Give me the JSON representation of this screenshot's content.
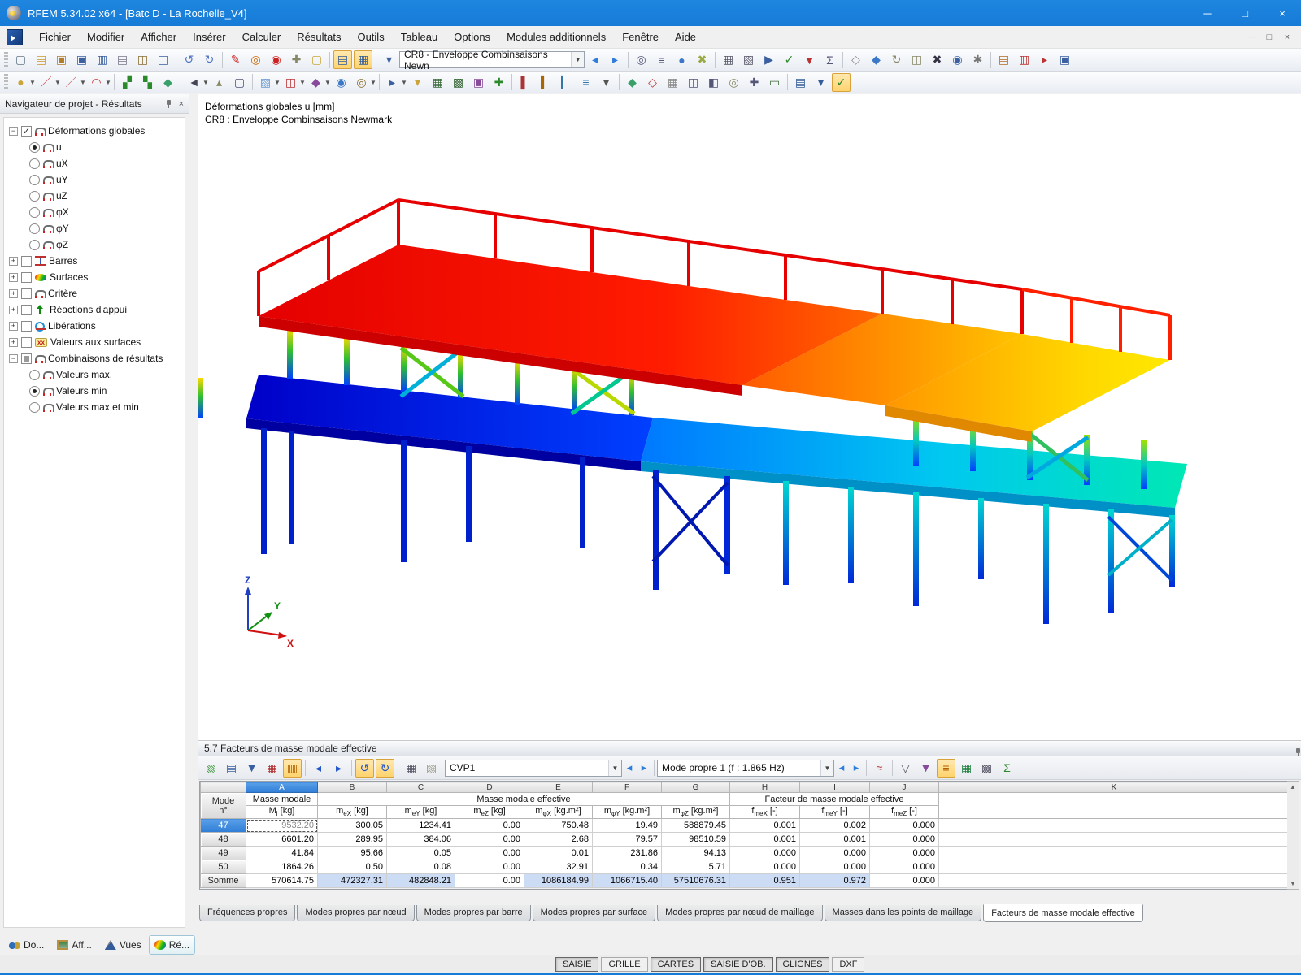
{
  "window": {
    "title": "RFEM 5.34.02 x64 - [Batc D - La Rochelle_V4]",
    "controls": {
      "minimize": "─",
      "maximize": "□",
      "close": "×"
    }
  },
  "menu": {
    "items": [
      "Fichier",
      "Modifier",
      "Afficher",
      "Insérer",
      "Calculer",
      "Résultats",
      "Outils",
      "Tableau",
      "Options",
      "Modules additionnels",
      "Fenêtre",
      "Aide"
    ]
  },
  "toolbars": {
    "case_combo": "CR8 - Enveloppe Combinsaisons Newn",
    "row1a": [
      {
        "n": "new-file",
        "g": "▢",
        "c": "#667788"
      },
      {
        "n": "open-file",
        "g": "▤",
        "c": "#c9972a"
      },
      {
        "n": "open-project",
        "g": "▣",
        "c": "#b07c2a"
      },
      {
        "n": "save-copy",
        "g": "▣",
        "c": "#3b5fa0"
      },
      {
        "n": "save",
        "g": "▥",
        "c": "#3b5fa0"
      },
      {
        "n": "print",
        "g": "▤",
        "c": "#778"
      },
      {
        "n": "print-preview",
        "g": "◫",
        "c": "#8a6d2f"
      },
      {
        "n": "export",
        "g": "◫",
        "c": "#3b5fa0"
      },
      "sep",
      {
        "n": "undo",
        "g": "↺",
        "c": "#4f73c4"
      },
      {
        "n": "redo",
        "g": "↻",
        "c": "#4f73c4"
      },
      "sep",
      {
        "n": "edit-polyline",
        "g": "✎",
        "c": "#c22"
      },
      {
        "n": "zoom-target",
        "g": "◎",
        "c": "#c60"
      },
      {
        "n": "zoom-center",
        "g": "◉",
        "c": "#c22"
      },
      {
        "n": "pick-object",
        "g": "✚",
        "c": "#886"
      },
      {
        "n": "new-comment",
        "g": "▢",
        "c": "#c9a83c"
      },
      "sep",
      {
        "n": "show-tables",
        "g": "▤",
        "c": "#335c99",
        "active": true
      },
      {
        "n": "show-grid-tables",
        "g": "▦",
        "c": "#335c99",
        "active": true
      },
      "sep",
      {
        "n": "result-case",
        "g": "▾",
        "c": "#3b5fa0"
      }
    ],
    "row1b": [
      {
        "n": "prev-case",
        "g": "◂",
        "c": "#2f7ddb"
      },
      {
        "n": "next-case",
        "g": "▸",
        "c": "#2f7ddb"
      },
      "sep",
      {
        "n": "find-numbering",
        "g": "◎",
        "c": "#557"
      },
      {
        "n": "xyz-coords",
        "g": "≡",
        "c": "#557"
      },
      {
        "n": "world-view",
        "g": "●",
        "c": "#3b78c8"
      },
      {
        "n": "axes-toggle",
        "g": "✖",
        "c": "#9a4"
      },
      "sep",
      {
        "n": "mesh",
        "g": "▦",
        "c": "#556"
      },
      {
        "n": "mesh-settings",
        "g": "▧",
        "c": "#556"
      },
      {
        "n": "calculate-all",
        "g": "▶",
        "c": "#3b5fa0"
      },
      {
        "n": "check-model",
        "g": "✓",
        "c": "#2a8a2a"
      },
      {
        "n": "loads-display",
        "g": "▼",
        "c": "#b33"
      },
      {
        "n": "results-display",
        "g": "Σ",
        "c": "#557"
      },
      "sep",
      {
        "n": "snap",
        "g": "◇",
        "c": "#888"
      },
      {
        "n": "guidelines",
        "g": "◆",
        "c": "#3b78c8"
      },
      {
        "n": "rotate-view",
        "g": "↻",
        "c": "#886"
      },
      {
        "n": "mirror",
        "g": "◫",
        "c": "#886"
      },
      {
        "n": "cut-plane",
        "g": "✖",
        "c": "#334"
      },
      {
        "n": "info",
        "g": "◉",
        "c": "#3b5fa0"
      },
      {
        "n": "settings",
        "g": "✱",
        "c": "#777"
      },
      "sep",
      {
        "n": "panel-toggle",
        "g": "▤",
        "c": "#b36a1f"
      },
      {
        "n": "print-graphic",
        "g": "▥",
        "c": "#b33"
      },
      {
        "n": "send",
        "g": "▸",
        "c": "#b33"
      },
      {
        "n": "help-layers",
        "g": "▣",
        "c": "#3b5fa0"
      }
    ],
    "row2": [
      {
        "n": "node",
        "g": "●",
        "c": "#caa53c",
        "caret": true
      },
      {
        "n": "line",
        "g": "／",
        "c": "#c33",
        "caret": true
      },
      {
        "n": "line-polyline",
        "g": "／",
        "c": "#b55",
        "caret": true
      },
      {
        "n": "arc",
        "g": "◠",
        "c": "#c33",
        "caret": true
      },
      "sep",
      {
        "n": "member",
        "g": "▞",
        "c": "#2a8a2a"
      },
      {
        "n": "member-set",
        "g": "▚",
        "c": "#2a8a2a"
      },
      {
        "n": "surface-new",
        "g": "◆",
        "c": "#3aa06a"
      },
      "sep",
      {
        "n": "dimension",
        "g": "◄",
        "c": "#445",
        "caret": true
      },
      {
        "n": "annotate",
        "g": "▴",
        "c": "#886"
      },
      {
        "n": "frame",
        "g": "▢",
        "c": "#557"
      },
      "sep",
      {
        "n": "select-area",
        "g": "▧",
        "c": "#6a9ad0",
        "caret": true
      },
      {
        "n": "box-select",
        "g": "◫",
        "c": "#b33",
        "caret": true
      },
      {
        "n": "visibility",
        "g": "◆",
        "c": "#884a9a",
        "caret": true
      },
      {
        "n": "render-solid",
        "g": "◉",
        "c": "#3b78c8"
      },
      {
        "n": "render-wire",
        "g": "◎",
        "c": "#8a6d2f",
        "caret": true
      },
      "sep",
      {
        "n": "numbering",
        "g": "▸",
        "c": "#3b5fa0",
        "caret": true
      },
      {
        "n": "load-case-view",
        "g": "▾",
        "c": "#caa53c"
      },
      {
        "n": "generate-mesh",
        "g": "▦",
        "c": "#3a6a3a"
      },
      {
        "n": "refine-mesh",
        "g": "▩",
        "c": "#3a6a3a"
      },
      {
        "n": "fe-settings",
        "g": "▣",
        "c": "#884a9a"
      },
      {
        "n": "supports",
        "g": "✚",
        "c": "#2a8a2a"
      },
      "sep",
      {
        "n": "results-members",
        "g": "▌",
        "c": "#a33"
      },
      {
        "n": "results-surfaces",
        "g": "▍",
        "c": "#a60"
      },
      {
        "n": "results-values",
        "g": "▎",
        "c": "#37a"
      },
      {
        "n": "smooth",
        "g": "≡",
        "c": "#37a"
      },
      {
        "n": "scale",
        "g": "▾",
        "c": "#555"
      },
      "sep",
      {
        "n": "clipping",
        "g": "◆",
        "c": "#3aa06a"
      },
      {
        "n": "section",
        "g": "◇",
        "c": "#b33"
      },
      {
        "n": "background",
        "g": "▦",
        "c": "#888"
      },
      {
        "n": "view-3d",
        "g": "◫",
        "c": "#557"
      },
      {
        "n": "isometric",
        "g": "◧",
        "c": "#557"
      },
      {
        "n": "zoom-window",
        "g": "◎",
        "c": "#886"
      },
      {
        "n": "pan",
        "g": "✚",
        "c": "#557"
      },
      {
        "n": "measure",
        "g": "▭",
        "c": "#3a6a3a"
      },
      "sep",
      {
        "n": "print-report",
        "g": "▤",
        "c": "#335c99"
      },
      {
        "n": "report-settings",
        "g": "▾",
        "c": "#335c99"
      },
      {
        "n": "check",
        "g": "✓",
        "c": "#2a8a2a",
        "active": true
      }
    ],
    "table_toolbar": [
      {
        "n": "table-edit-mode",
        "g": "▧",
        "c": "#2f8f2f"
      },
      {
        "n": "table-jump",
        "g": "▤",
        "c": "#3b5fa0"
      },
      {
        "n": "table-row-down",
        "g": "▼",
        "c": "#3b5fa0"
      },
      {
        "n": "table-red-values",
        "g": "▦",
        "c": "#b03030"
      },
      {
        "n": "table-histogram",
        "g": "▥",
        "c": "#b06000",
        "active": true
      },
      "sep",
      {
        "n": "col-prev",
        "g": "◂",
        "c": "#2255cc"
      },
      {
        "n": "col-next",
        "g": "▸",
        "c": "#2255cc"
      },
      "sep",
      {
        "n": "table-undo",
        "g": "↺",
        "c": "#2255cc",
        "active": true
      },
      {
        "n": "table-redo",
        "g": "↻",
        "c": "#2255cc",
        "active": true
      },
      "sep",
      {
        "n": "table-grid-view",
        "g": "▦",
        "c": "#556"
      },
      {
        "n": "table-export-view",
        "g": "▧",
        "c": "#998"
      }
    ],
    "table_toolbar2": [
      {
        "n": "result-diagram",
        "g": "≈",
        "c": "#b33"
      },
      "sep",
      {
        "n": "filter",
        "g": "▽",
        "c": "#556"
      },
      {
        "n": "filter-relations",
        "g": "▼",
        "c": "#884a9a"
      },
      {
        "n": "bar-diagram",
        "g": "≡",
        "c": "#b06000",
        "active": true
      },
      {
        "n": "excel-export",
        "g": "▦",
        "c": "#1f7f3f"
      },
      {
        "n": "calculator",
        "g": "▩",
        "c": "#556"
      },
      {
        "n": "decimal-places",
        "g": "Σ",
        "c": "#2a8a2a"
      }
    ]
  },
  "navigator": {
    "title": "Navigateur de projet - Résultats",
    "tree": [
      {
        "label": "Déformations globales",
        "lvl": 0,
        "exp": "minus",
        "ctl": "check-on",
        "ico": "arch"
      },
      {
        "label": "u",
        "lvl": 1,
        "ctl": "radio-on",
        "ico": "arch"
      },
      {
        "label": "uX",
        "lvl": 1,
        "ctl": "radio-off",
        "ico": "arch"
      },
      {
        "label": "uY",
        "lvl": 1,
        "ctl": "radio-off",
        "ico": "arch"
      },
      {
        "label": "uZ",
        "lvl": 1,
        "ctl": "radio-off",
        "ico": "arch"
      },
      {
        "label": "φX",
        "lvl": 1,
        "ctl": "radio-off",
        "ico": "arch"
      },
      {
        "label": "φY",
        "lvl": 1,
        "ctl": "radio-off",
        "ico": "arch"
      },
      {
        "label": "φZ",
        "lvl": 1,
        "ctl": "radio-off",
        "ico": "arch"
      },
      {
        "label": "Barres",
        "lvl": 0,
        "exp": "plus",
        "ctl": "check-off",
        "ico": "beam"
      },
      {
        "label": "Surfaces",
        "lvl": 0,
        "exp": "plus",
        "ctl": "check-off",
        "ico": "surface"
      },
      {
        "label": "Critère",
        "lvl": 0,
        "exp": "plus",
        "ctl": "check-off",
        "ico": "arch"
      },
      {
        "label": "Réactions d'appui",
        "lvl": 0,
        "exp": "plus",
        "ctl": "check-off",
        "ico": "react"
      },
      {
        "label": "Libérations",
        "lvl": 0,
        "exp": "plus",
        "ctl": "check-off",
        "ico": "liber"
      },
      {
        "label": "Valeurs aux surfaces",
        "lvl": 0,
        "exp": "plus",
        "ctl": "check-off",
        "ico": "xx"
      },
      {
        "label": "Combinaisons de résultats",
        "lvl": 0,
        "exp": "minus",
        "ctl": "check-part",
        "ico": "arch"
      },
      {
        "label": "Valeurs max.",
        "lvl": 1,
        "ctl": "radio-off",
        "ico": "arch"
      },
      {
        "label": "Valeurs min",
        "lvl": 1,
        "ctl": "radio-on",
        "ico": "arch"
      },
      {
        "label": "Valeurs max et min",
        "lvl": 1,
        "ctl": "radio-off",
        "ico": "arch"
      }
    ]
  },
  "icons": {
    "xx_label": "xx",
    "plus": "+",
    "minus": "−",
    "pin": "pin",
    "close": "×"
  },
  "viewport": {
    "legend_line1": "Déformations globales u [mm]",
    "legend_line2": "CR8 : Enveloppe Combinsaisons Newmark",
    "axis": {
      "x": "X",
      "y": "Y",
      "z": "Z"
    }
  },
  "table_panel": {
    "title": "5.7 Facteurs de masse modale effective",
    "cvp_combo": "CVP1",
    "mode_combo": "Mode propre 1 (f : 1.865 Hz)",
    "col_letters": [
      "A",
      "B",
      "C",
      "D",
      "E",
      "F",
      "G",
      "H",
      "I",
      "J",
      "K"
    ],
    "header": {
      "mode_line1": "Mode",
      "mode_line2": "n°",
      "col_a_group": "Masse modale",
      "group_b_g": "Masse modale effective",
      "group_h_j": "Facteur de masse modale effective",
      "units": [
        {
          "b": "M",
          "s": "i",
          "u": "[kg]"
        },
        {
          "b": "m",
          "s": "eX",
          "u": "[kg]"
        },
        {
          "b": "m",
          "s": "eY",
          "u": "[kg]"
        },
        {
          "b": "m",
          "s": "eZ",
          "u": "[kg]"
        },
        {
          "b": "m",
          "s": "φX",
          "u": "[kg.m²]"
        },
        {
          "b": "m",
          "s": "φY",
          "u": "[kg.m²]"
        },
        {
          "b": "m",
          "s": "φZ",
          "u": "[kg.m²]"
        },
        {
          "b": "f",
          "s": "meX",
          "u": "[-]"
        },
        {
          "b": "f",
          "s": "meY",
          "u": "[-]"
        },
        {
          "b": "f",
          "s": "meZ",
          "u": "[-]"
        }
      ]
    },
    "rows": [
      {
        "mode": "47",
        "sel": true,
        "a_sel": true,
        "cells": [
          "9532.20",
          "300.05",
          "1234.41",
          "0.00",
          "750.48",
          "19.49",
          "588879.45",
          "0.001",
          "0.002",
          "0.000"
        ],
        "hl": []
      },
      {
        "mode": "48",
        "cells": [
          "6601.20",
          "289.95",
          "384.06",
          "0.00",
          "2.68",
          "79.57",
          "98510.59",
          "0.001",
          "0.001",
          "0.000"
        ],
        "hl": []
      },
      {
        "mode": "49",
        "cells": [
          "41.84",
          "95.66",
          "0.05",
          "0.00",
          "0.01",
          "231.86",
          "94.13",
          "0.000",
          "0.000",
          "0.000"
        ],
        "hl": []
      },
      {
        "mode": "50",
        "cells": [
          "1864.26",
          "0.50",
          "0.08",
          "0.00",
          "32.91",
          "0.34",
          "5.71",
          "0.000",
          "0.000",
          "0.000"
        ],
        "hl": []
      },
      {
        "mode": "Somme",
        "cells": [
          "570614.75",
          "472327.31",
          "482848.21",
          "0.00",
          "1086184.99",
          "1066715.40",
          "57510676.31",
          "0.951",
          "0.972",
          "0.000"
        ],
        "hl": [
          1,
          2,
          4,
          5,
          6,
          7,
          8
        ]
      }
    ],
    "tabs": [
      {
        "label": "Fréquences propres"
      },
      {
        "label": "Modes propres par nœud"
      },
      {
        "label": "Modes propres par barre"
      },
      {
        "label": "Modes propres par surface"
      },
      {
        "label": "Modes propres par nœud de maillage"
      },
      {
        "label": "Masses dans les points de maillage"
      },
      {
        "label": "Facteurs de masse modale effective",
        "active": true
      }
    ]
  },
  "panel_tabs": [
    {
      "label": "Do...",
      "icon": "binoculars"
    },
    {
      "label": "Aff...",
      "icon": "display"
    },
    {
      "label": "Vues",
      "icon": "views"
    },
    {
      "label": "Ré...",
      "icon": "results",
      "active": true
    }
  ],
  "statusbar": {
    "segments": [
      {
        "label": "SAISIE",
        "on": true
      },
      {
        "label": "GRILLE",
        "on": false
      },
      {
        "label": "CARTES",
        "on": true
      },
      {
        "label": "SAISIE D'OB.",
        "on": true
      },
      {
        "label": "GLIGNES",
        "on": true
      },
      {
        "label": "DXF",
        "on": false
      }
    ]
  },
  "colors": {
    "titlebar": "#157bd6",
    "selection": "#2f7dd6",
    "sum_highlight": "#cddcf5",
    "toolbar_active": "#ffd36e"
  }
}
